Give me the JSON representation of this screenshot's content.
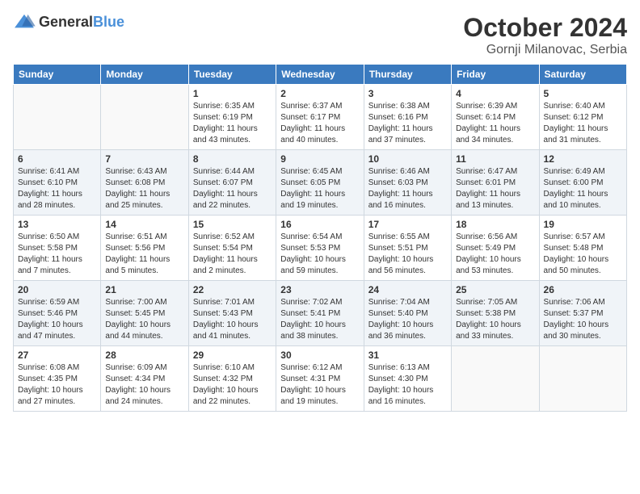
{
  "header": {
    "logo_general": "General",
    "logo_blue": "Blue",
    "month": "October 2024",
    "location": "Gornji Milanovac, Serbia"
  },
  "weekdays": [
    "Sunday",
    "Monday",
    "Tuesday",
    "Wednesday",
    "Thursday",
    "Friday",
    "Saturday"
  ],
  "weeks": [
    [
      {
        "day": "",
        "sunrise": "",
        "sunset": "",
        "daylight": ""
      },
      {
        "day": "",
        "sunrise": "",
        "sunset": "",
        "daylight": ""
      },
      {
        "day": "1",
        "sunrise": "Sunrise: 6:35 AM",
        "sunset": "Sunset: 6:19 PM",
        "daylight": "Daylight: 11 hours and 43 minutes."
      },
      {
        "day": "2",
        "sunrise": "Sunrise: 6:37 AM",
        "sunset": "Sunset: 6:17 PM",
        "daylight": "Daylight: 11 hours and 40 minutes."
      },
      {
        "day": "3",
        "sunrise": "Sunrise: 6:38 AM",
        "sunset": "Sunset: 6:16 PM",
        "daylight": "Daylight: 11 hours and 37 minutes."
      },
      {
        "day": "4",
        "sunrise": "Sunrise: 6:39 AM",
        "sunset": "Sunset: 6:14 PM",
        "daylight": "Daylight: 11 hours and 34 minutes."
      },
      {
        "day": "5",
        "sunrise": "Sunrise: 6:40 AM",
        "sunset": "Sunset: 6:12 PM",
        "daylight": "Daylight: 11 hours and 31 minutes."
      }
    ],
    [
      {
        "day": "6",
        "sunrise": "Sunrise: 6:41 AM",
        "sunset": "Sunset: 6:10 PM",
        "daylight": "Daylight: 11 hours and 28 minutes."
      },
      {
        "day": "7",
        "sunrise": "Sunrise: 6:43 AM",
        "sunset": "Sunset: 6:08 PM",
        "daylight": "Daylight: 11 hours and 25 minutes."
      },
      {
        "day": "8",
        "sunrise": "Sunrise: 6:44 AM",
        "sunset": "Sunset: 6:07 PM",
        "daylight": "Daylight: 11 hours and 22 minutes."
      },
      {
        "day": "9",
        "sunrise": "Sunrise: 6:45 AM",
        "sunset": "Sunset: 6:05 PM",
        "daylight": "Daylight: 11 hours and 19 minutes."
      },
      {
        "day": "10",
        "sunrise": "Sunrise: 6:46 AM",
        "sunset": "Sunset: 6:03 PM",
        "daylight": "Daylight: 11 hours and 16 minutes."
      },
      {
        "day": "11",
        "sunrise": "Sunrise: 6:47 AM",
        "sunset": "Sunset: 6:01 PM",
        "daylight": "Daylight: 11 hours and 13 minutes."
      },
      {
        "day": "12",
        "sunrise": "Sunrise: 6:49 AM",
        "sunset": "Sunset: 6:00 PM",
        "daylight": "Daylight: 11 hours and 10 minutes."
      }
    ],
    [
      {
        "day": "13",
        "sunrise": "Sunrise: 6:50 AM",
        "sunset": "Sunset: 5:58 PM",
        "daylight": "Daylight: 11 hours and 7 minutes."
      },
      {
        "day": "14",
        "sunrise": "Sunrise: 6:51 AM",
        "sunset": "Sunset: 5:56 PM",
        "daylight": "Daylight: 11 hours and 5 minutes."
      },
      {
        "day": "15",
        "sunrise": "Sunrise: 6:52 AM",
        "sunset": "Sunset: 5:54 PM",
        "daylight": "Daylight: 11 hours and 2 minutes."
      },
      {
        "day": "16",
        "sunrise": "Sunrise: 6:54 AM",
        "sunset": "Sunset: 5:53 PM",
        "daylight": "Daylight: 10 hours and 59 minutes."
      },
      {
        "day": "17",
        "sunrise": "Sunrise: 6:55 AM",
        "sunset": "Sunset: 5:51 PM",
        "daylight": "Daylight: 10 hours and 56 minutes."
      },
      {
        "day": "18",
        "sunrise": "Sunrise: 6:56 AM",
        "sunset": "Sunset: 5:49 PM",
        "daylight": "Daylight: 10 hours and 53 minutes."
      },
      {
        "day": "19",
        "sunrise": "Sunrise: 6:57 AM",
        "sunset": "Sunset: 5:48 PM",
        "daylight": "Daylight: 10 hours and 50 minutes."
      }
    ],
    [
      {
        "day": "20",
        "sunrise": "Sunrise: 6:59 AM",
        "sunset": "Sunset: 5:46 PM",
        "daylight": "Daylight: 10 hours and 47 minutes."
      },
      {
        "day": "21",
        "sunrise": "Sunrise: 7:00 AM",
        "sunset": "Sunset: 5:45 PM",
        "daylight": "Daylight: 10 hours and 44 minutes."
      },
      {
        "day": "22",
        "sunrise": "Sunrise: 7:01 AM",
        "sunset": "Sunset: 5:43 PM",
        "daylight": "Daylight: 10 hours and 41 minutes."
      },
      {
        "day": "23",
        "sunrise": "Sunrise: 7:02 AM",
        "sunset": "Sunset: 5:41 PM",
        "daylight": "Daylight: 10 hours and 38 minutes."
      },
      {
        "day": "24",
        "sunrise": "Sunrise: 7:04 AM",
        "sunset": "Sunset: 5:40 PM",
        "daylight": "Daylight: 10 hours and 36 minutes."
      },
      {
        "day": "25",
        "sunrise": "Sunrise: 7:05 AM",
        "sunset": "Sunset: 5:38 PM",
        "daylight": "Daylight: 10 hours and 33 minutes."
      },
      {
        "day": "26",
        "sunrise": "Sunrise: 7:06 AM",
        "sunset": "Sunset: 5:37 PM",
        "daylight": "Daylight: 10 hours and 30 minutes."
      }
    ],
    [
      {
        "day": "27",
        "sunrise": "Sunrise: 6:08 AM",
        "sunset": "Sunset: 4:35 PM",
        "daylight": "Daylight: 10 hours and 27 minutes."
      },
      {
        "day": "28",
        "sunrise": "Sunrise: 6:09 AM",
        "sunset": "Sunset: 4:34 PM",
        "daylight": "Daylight: 10 hours and 24 minutes."
      },
      {
        "day": "29",
        "sunrise": "Sunrise: 6:10 AM",
        "sunset": "Sunset: 4:32 PM",
        "daylight": "Daylight: 10 hours and 22 minutes."
      },
      {
        "day": "30",
        "sunrise": "Sunrise: 6:12 AM",
        "sunset": "Sunset: 4:31 PM",
        "daylight": "Daylight: 10 hours and 19 minutes."
      },
      {
        "day": "31",
        "sunrise": "Sunrise: 6:13 AM",
        "sunset": "Sunset: 4:30 PM",
        "daylight": "Daylight: 10 hours and 16 minutes."
      },
      {
        "day": "",
        "sunrise": "",
        "sunset": "",
        "daylight": ""
      },
      {
        "day": "",
        "sunrise": "",
        "sunset": "",
        "daylight": ""
      }
    ]
  ]
}
